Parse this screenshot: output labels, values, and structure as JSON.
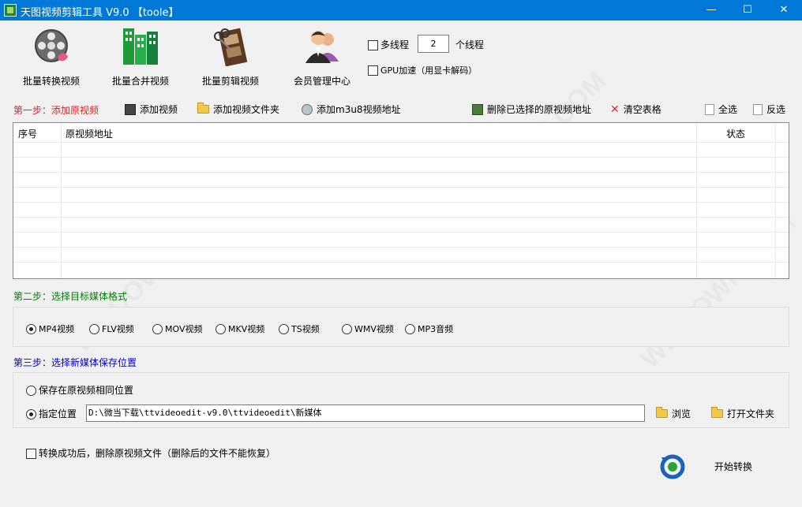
{
  "window": {
    "title": "天图视频剪辑工具 V9.0 【toole】",
    "min_glyph": "—",
    "max_glyph": "☐",
    "close_glyph": "✕"
  },
  "toolbar": {
    "batch_convert": "批量转换视频",
    "batch_merge": "批量合并视频",
    "batch_clip": "批量剪辑视频",
    "member_center": "会员管理中心"
  },
  "options": {
    "multithread_label": "多线程",
    "thread_count": "2",
    "thread_unit": "个线程",
    "gpu_label": "GPU加速（用显卡解码）"
  },
  "step1": {
    "label": "第一步：添加原视频",
    "add_video": "添加视频",
    "add_folder": "添加视频文件夹",
    "add_m3u8": "添加m3u8视频地址",
    "delete_selected": "删除已选择的原视频地址",
    "clear_table": "清空表格",
    "select_all": "全选",
    "invert_select": "反选"
  },
  "grid": {
    "columns": [
      "序号",
      "原视频地址",
      "状态"
    ]
  },
  "step2": {
    "label": "第二步：选择目标媒体格式",
    "formats": [
      "MP4视频",
      "FLV视频",
      "MOV视频",
      "MKV视频",
      "TS视频",
      "WMV视频",
      "MP3音频"
    ],
    "selected": "MP4视频"
  },
  "step3": {
    "label": "第三步：选择新媒体保存位置",
    "same_location": "保存在原视频相同位置",
    "custom_location": "指定位置",
    "path": "D:\\微当下载\\ttvideoedit-v9.0\\ttvideoedit\\新媒体",
    "browse": "浏览",
    "open_folder": "打开文件夹"
  },
  "footer": {
    "delete_after": "转换成功后，删除原视频文件（删除后的文件不能恢复）",
    "start": "开始转换"
  },
  "colors": {
    "titlebar": "#0078d7",
    "step1": "#e02020",
    "step2": "#008000",
    "step3": "#0000cc"
  }
}
